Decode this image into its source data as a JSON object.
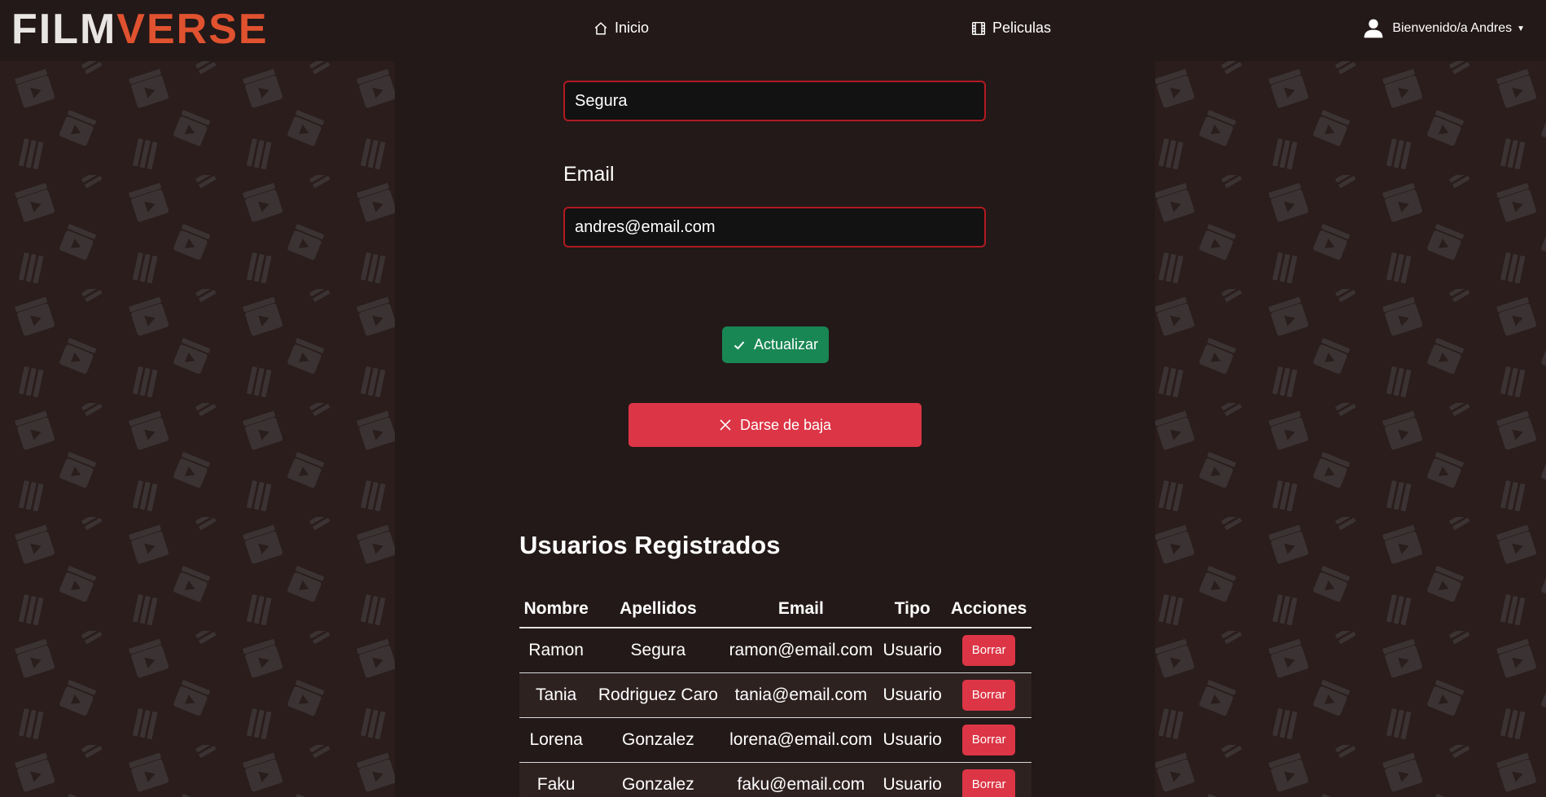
{
  "brand": {
    "part1": "FILM",
    "part2": "VERSE"
  },
  "nav": {
    "home_label": "Inicio",
    "home_icon": "home-icon",
    "movies_label": "Peliculas",
    "movies_icon": "film-icon",
    "user_label": "Bienvenido/a Andres",
    "user_icon": "user-icon"
  },
  "form": {
    "surname_value": "Segura",
    "email_label": "Email",
    "email_value": "andres@email.com",
    "update_label": "Actualizar",
    "delete_account_label": "Darse de baja"
  },
  "users_section": {
    "title": "Usuarios Registrados",
    "columns": [
      "Nombre",
      "Apellidos",
      "Email",
      "Tipo",
      "Acciones"
    ],
    "rows": [
      {
        "nombre": "Ramon",
        "apellidos": "Segura",
        "email": "ramon@email.com",
        "tipo": "Usuario",
        "accion": "Borrar"
      },
      {
        "nombre": "Tania",
        "apellidos": "Rodriguez Caro",
        "email": "tania@email.com",
        "tipo": "Usuario",
        "accion": "Borrar"
      },
      {
        "nombre": "Lorena",
        "apellidos": "Gonzalez",
        "email": "lorena@email.com",
        "tipo": "Usuario",
        "accion": "Borrar"
      },
      {
        "nombre": "Faku",
        "apellidos": "Gonzalez",
        "email": "faku@email.com",
        "tipo": "Usuario",
        "accion": "Borrar"
      }
    ]
  },
  "colors": {
    "brand_accent": "#e0522f",
    "success": "#198754",
    "danger": "#dc3545",
    "input_border": "#b01a22"
  }
}
